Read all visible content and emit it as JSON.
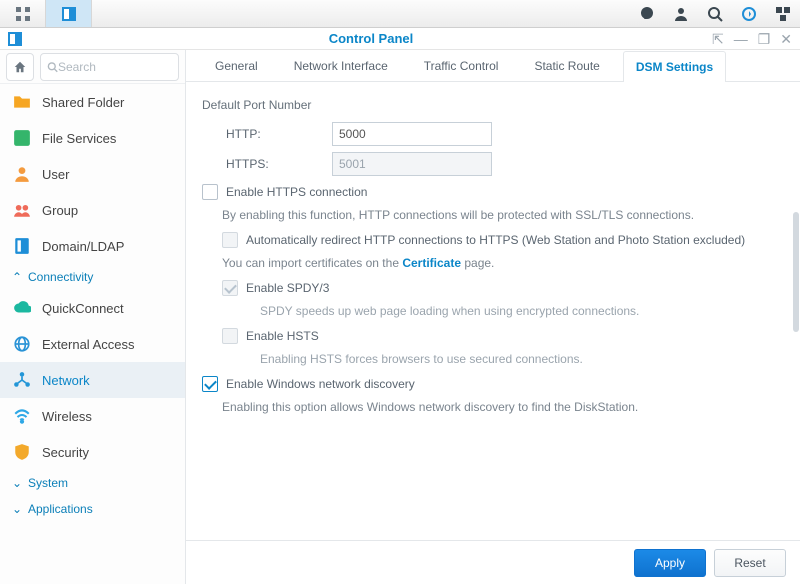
{
  "taskbar": {
    "right_icons": [
      "chat-icon",
      "user-icon",
      "search-icon",
      "refresh-icon",
      "widgets-icon"
    ]
  },
  "window": {
    "title": "Control Panel",
    "controls": [
      "pin",
      "minimize",
      "maximize",
      "close"
    ]
  },
  "search": {
    "placeholder": "Search"
  },
  "sidebar": {
    "items": [
      {
        "label": "Shared Folder",
        "icon": "folder",
        "color": "#f6a623"
      },
      {
        "label": "File Services",
        "icon": "grid",
        "color": "#34b56b"
      },
      {
        "label": "User",
        "icon": "person",
        "color": "#f49b3f"
      },
      {
        "label": "Group",
        "icon": "people",
        "color": "#ef6b5a"
      },
      {
        "label": "Domain/LDAP",
        "icon": "book",
        "color": "#1e8ed7"
      }
    ],
    "group_conn": "Connectivity",
    "conn_items": [
      {
        "label": "QuickConnect",
        "icon": "cloud",
        "color": "#1bb8a0"
      },
      {
        "label": "External Access",
        "icon": "globe",
        "color": "#2a93d6"
      },
      {
        "label": "Network",
        "icon": "net",
        "color": "#2396d7",
        "active": true
      },
      {
        "label": "Wireless",
        "icon": "wifi",
        "color": "#2fa8e6"
      },
      {
        "label": "Security",
        "icon": "shield",
        "color": "#f3a92b"
      }
    ],
    "group_system": "System",
    "group_apps": "Applications"
  },
  "tabs": [
    "General",
    "Network Interface",
    "Traffic Control",
    "Static Route",
    "DSM Settings"
  ],
  "active_tab": "DSM Settings",
  "form": {
    "section": "Default Port Number",
    "http_label": "HTTP:",
    "http_value": "5000",
    "https_label": "HTTPS:",
    "https_value": "5001",
    "chk_https": "Enable HTTPS connection",
    "help_https": "By enabling this function, HTTP connections will be protected with SSL/TLS connections.",
    "chk_redirect": "Automatically redirect HTTP connections to HTTPS (Web Station and Photo Station excluded)",
    "cert_prefix": "You can import certificates on the ",
    "cert_link": "Certificate",
    "cert_suffix": " page.",
    "chk_spdy": "Enable SPDY/3",
    "help_spdy": "SPDY speeds up web page loading when using encrypted connections.",
    "chk_hsts": "Enable HSTS",
    "help_hsts": "Enabling HSTS forces browsers to use secured connections.",
    "chk_win": "Enable Windows network discovery",
    "help_win": "Enabling this option allows Windows network discovery to find the DiskStation."
  },
  "footer": {
    "apply": "Apply",
    "reset": "Reset"
  }
}
